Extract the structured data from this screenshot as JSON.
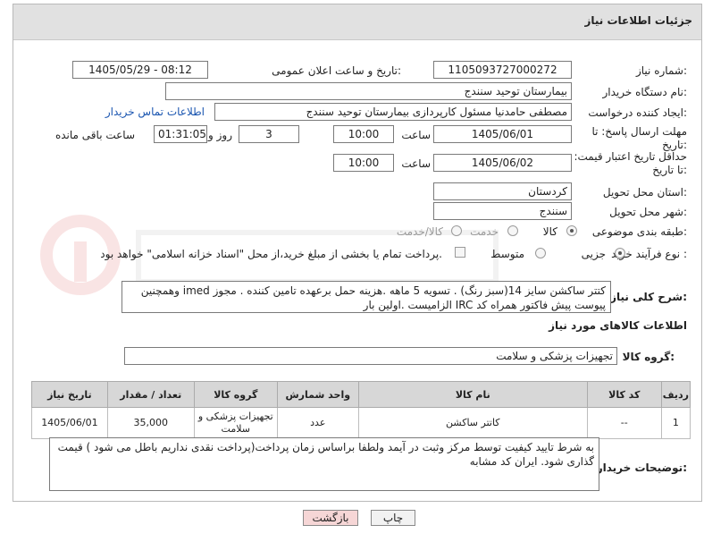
{
  "header": {
    "title": "جزئیات اطلاعات نیاز"
  },
  "fields": {
    "need_number_label": "شماره نیاز:",
    "need_number": "1105093727000272",
    "announce_label": "تاریخ و ساعت اعلان عمومی:",
    "announce_value": "1405/05/29 - 08:12",
    "buyer_org_label": "نام دستگاه خریدار:",
    "buyer_org": "بیمارستان توحید سنندج",
    "creator_label": "ایجاد کننده درخواست:",
    "creator": "مصطفی حامدنیا مسئول کارپردازی بیمارستان توحید سنندج",
    "contact_link": "اطلاعات تماس خریدار",
    "deadline_label": "مهلت ارسال پاسخ: تا تاریخ:",
    "deadline_date": "1405/06/01",
    "time_label": "ساعت",
    "deadline_time": "10:00",
    "days_value": "3",
    "days_label": "روز و",
    "remaining_time": "01:31:05",
    "remaining_label": "ساعت باقی مانده",
    "price_validity_label": "حداقل تاریخ اعتبار قیمت: تا تاریخ:",
    "price_date": "1405/06/02",
    "price_time": "10:00",
    "province_label": "استان محل تحویل:",
    "province": "کردستان",
    "city_label": "شهر محل تحویل:",
    "city": "سنندج",
    "category_label": "طبقه بندی موضوعی:",
    "category_options": [
      "کالا",
      "خدمت",
      "کالا/خدمت"
    ],
    "process_label": "نوع فرآیند خرید :",
    "process_options": [
      "جزیی",
      "متوسط"
    ],
    "payment_note": "پرداخت تمام یا بخشی از مبلغ خرید،از محل \"اسناد خزانه اسلامی\" خواهد بود.",
    "description_label": "شرح کلی نیاز:",
    "description": "کتتر ساکشن  سایز 14(سبز رنگ) . تسویه 5 ماهه .هزینه حمل برعهده تامین کننده . مجوز imed وهمچنین پیوست پیش فاکتور همراه کد IRC  الزامیست .اولین بار",
    "goods_info_title": "اطلاعات کالاهای مورد نیاز",
    "goods_group_label": "گروه کالا:",
    "goods_group": "تجهیزات پزشکی و سلامت",
    "buyer_notes_label": "توضیحات خریدار:",
    "buyer_notes": "به شرط تایید کیفیت توسط مرکز وثبت در آیمد ولطفا براساس زمان پرداخت(پرداخت نقدی نداریم باطل می شود ) قیمت گذاری شود. ایران کد مشابه"
  },
  "table": {
    "headers": [
      "ردیف",
      "کد کالا",
      "نام کالا",
      "واحد شمارش",
      "گروه کالا",
      "تعداد / مقدار",
      "تاریخ نیاز"
    ],
    "rows": [
      [
        "1",
        "--",
        "کاتتر ساکشن",
        "عدد",
        "تجهیزات پزشکی و سلامت",
        "35,000",
        "1405/06/01"
      ]
    ]
  },
  "buttons": {
    "print": "چاپ",
    "back": "بازگشت"
  },
  "colors": {
    "title_bar": "#e1e1e1",
    "table_header": "#d7d7d7",
    "link": "#1a55b0",
    "back_button": "#f6d6d6"
  }
}
